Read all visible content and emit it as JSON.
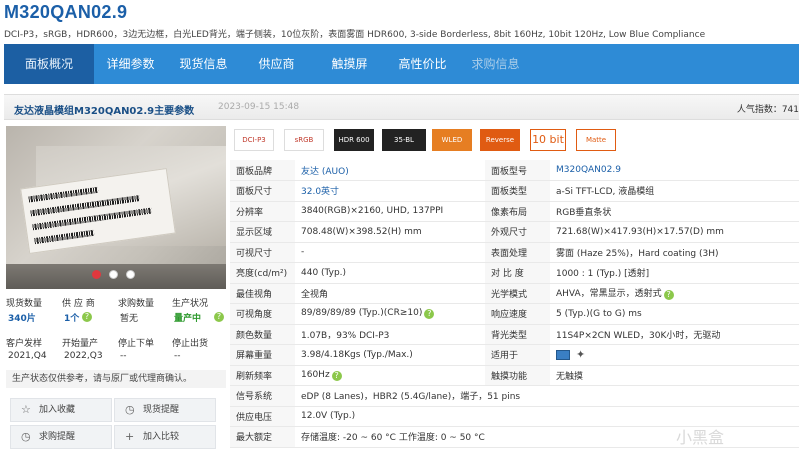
{
  "header": {
    "title": "M320QAN02.9",
    "subtitle": "DCI-P3，sRGB，HDR600，3边无边框，白光LED背光，端子侧装，10位灰阶，表面雾面   HDR600, 3-side Borderless, 8bit 160Hz, 10bit 120Hz, Low Blue Compliance"
  },
  "nav": {
    "tabs": [
      {
        "label": "面板概况",
        "state": "active"
      },
      {
        "label": "详细参数",
        "state": "normal"
      },
      {
        "label": "现货信息",
        "state": "normal"
      },
      {
        "label": "供应商",
        "state": "normal"
      },
      {
        "label": "触摸屏",
        "state": "normal"
      },
      {
        "label": "高性价比",
        "state": "normal"
      },
      {
        "label": "求购信息",
        "state": "muted"
      }
    ]
  },
  "panel": {
    "title": "友达液晶模组M320QAN02.9主要参数",
    "date": "2023-09-15 15:48",
    "popularity_label": "人气指数：741"
  },
  "photo": {
    "carousel_dots": 3,
    "active_dot": 0
  },
  "stats": {
    "row1_labels": [
      "现货数量",
      "供 应 商",
      "求购数量",
      "生产状况"
    ],
    "row1_values": [
      "340片",
      "1个",
      "暂无",
      "量产中"
    ],
    "row2_labels": [
      "客户发样",
      "开始量产",
      "停止下单",
      "停止出货"
    ],
    "row2_values": [
      "2021,Q4",
      "2022,Q3",
      "--",
      "--"
    ],
    "notice": "生产状态仅供参考，请与原厂或代理商确认。"
  },
  "actions": [
    {
      "label": "加入收藏",
      "icon": "star-icon",
      "glyph": "☆"
    },
    {
      "label": "现货提醒",
      "icon": "bell-icon",
      "glyph": "🔔"
    },
    {
      "label": "求购提醒",
      "icon": "bell-icon",
      "glyph": "🔔"
    },
    {
      "label": "加入比较",
      "icon": "plus-icon",
      "glyph": "+"
    }
  ],
  "badges": [
    "DCI-P3",
    "sRGB",
    "HDR 600",
    "35-BL",
    "WLED",
    "Reverse",
    "10 bit",
    "Matte"
  ],
  "specs": [
    [
      "面板品牌",
      "友达 (AUO)",
      "面板型号",
      "M320QAN02.9"
    ],
    [
      "面板尺寸",
      "32.0英寸",
      "面板类型",
      "a-Si TFT-LCD, 液晶模组"
    ],
    [
      "分辨率",
      "3840(RGB)×2160, UHD, 137PPI",
      "像素布局",
      "RGB垂直条状"
    ],
    [
      "显示区域",
      "708.48(W)×398.52(H) mm",
      "外观尺寸",
      "721.68(W)×417.93(H)×17.57(D) mm"
    ],
    [
      "可视尺寸",
      "-",
      "表面处理",
      "雾面 (Haze 25%)，Hard coating (3H)"
    ],
    [
      "亮度(cd/m²)",
      "440 (Typ.)",
      "对 比 度",
      "1000 : 1 (Typ.) [透射]"
    ],
    [
      "最佳视角",
      "全视角",
      "光学模式",
      "AHVA，常黑显示，透射式"
    ],
    [
      "可视角度",
      "89/89/89/89 (Typ.)(CR≥10)",
      "响应速度",
      "5 (Typ.)(G to G) ms"
    ],
    [
      "颜色数量",
      "1.07B，93% DCI-P3",
      "背光类型",
      "11S4P×2CN WLED，30K小时，无驱动"
    ],
    [
      "屏幕重量",
      "3.98/4.18Kgs (Typ./Max.)",
      "适用于",
      ""
    ],
    [
      "刷新频率",
      "160Hz",
      "触摸功能",
      "无触摸"
    ],
    [
      "信号系统",
      "eDP (8 Lanes)，HBR2 (5.4G/lane)，端子，51 pins",
      "",
      ""
    ],
    [
      "供应电压",
      "12.0V (Typ.)",
      "",
      ""
    ],
    [
      "最大额定",
      "存储温度: -20 ~ 60 °C    工作温度: 0 ~ 50 °C",
      "",
      ""
    ]
  ],
  "watermark": "小黑盒"
}
